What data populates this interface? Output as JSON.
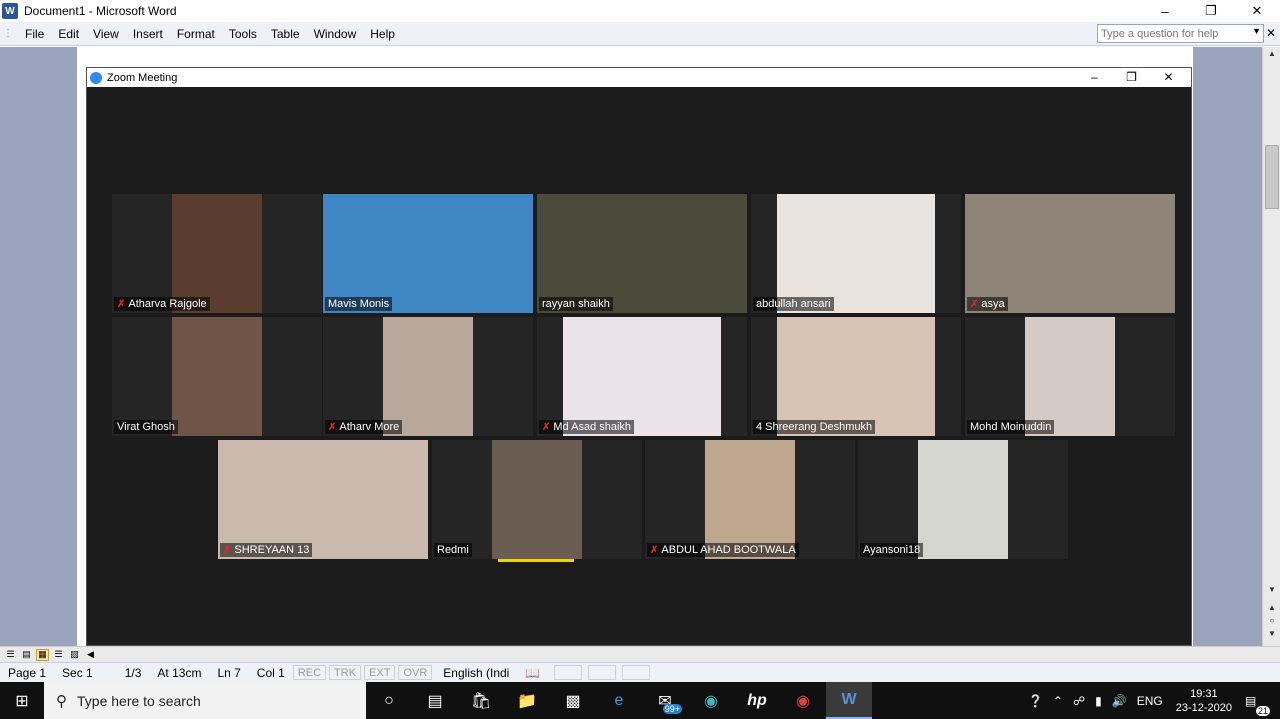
{
  "word": {
    "title": "Document1 - Microsoft Word",
    "app_icon": "W",
    "menu": [
      "File",
      "Edit",
      "View",
      "Insert",
      "Format",
      "Tools",
      "Table",
      "Window",
      "Help"
    ],
    "help_placeholder": "Type a question for help"
  },
  "zoom": {
    "title": "Zoom Meeting",
    "participants": [
      {
        "name": "Atharva Rajgole",
        "muted": true,
        "color": "#5a3d2e"
      },
      {
        "name": "Mavis Monis",
        "muted": false,
        "color": "#3f86c4",
        "active": true
      },
      {
        "name": "rayyan shaikh",
        "muted": false,
        "color": "#4a4a3a"
      },
      {
        "name": "abdullah ansari",
        "muted": false,
        "color": "#e9e4e0"
      },
      {
        "name": "asya",
        "muted": true,
        "color": "#8e8478"
      },
      {
        "name": "Virat Ghosh",
        "muted": false,
        "color": "#6e5548"
      },
      {
        "name": "Atharv More",
        "muted": true,
        "color": "#b9a89b"
      },
      {
        "name": "Md Asad shaikh",
        "muted": true,
        "color": "#eae3e8"
      },
      {
        "name": "4 Shreerang Deshmukh",
        "muted": false,
        "color": "#d8c3b4"
      },
      {
        "name": "Mohd Moinuddin",
        "muted": false,
        "color": "#d4cbc4"
      },
      {
        "name": "SHREYAAN 13",
        "muted": true,
        "color": "#cbb9ae"
      },
      {
        "name": "Redmi",
        "muted": false,
        "color": "#6a5c50"
      },
      {
        "name": "ABDUL AHAD BOOTWALA",
        "muted": true,
        "color": "#bfa890"
      },
      {
        "name": "Ayansoni18",
        "muted": false,
        "color": "#d5d6d0"
      }
    ]
  },
  "status": {
    "page": "Page 1",
    "sec": "Sec 1",
    "pages": "1/3",
    "at": "At 13cm",
    "ln": "Ln 7",
    "col": "Col 1",
    "rec": "REC",
    "trk": "TRK",
    "ext": "EXT",
    "ovr": "OVR",
    "lang": "English (Indi"
  },
  "taskbar": {
    "search_placeholder": "Type here to search",
    "mail_badge": "99+",
    "lang": "ENG",
    "time": "19:31",
    "date": "23-12-2020",
    "notifications": "21"
  }
}
